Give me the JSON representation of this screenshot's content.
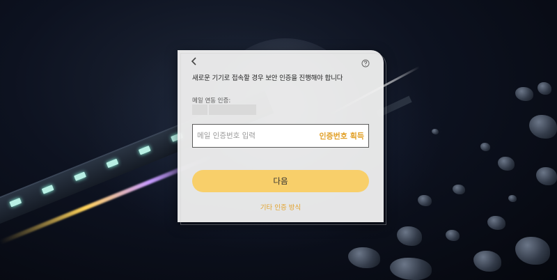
{
  "dialog": {
    "notice": "새로운 기기로 접속할 경우 보안 인증을 진행해야 합니다",
    "email_label": "메일 연동 인증:",
    "code_placeholder": "메일 인증번호 입력",
    "get_code_label": "인증번호 획득",
    "next_label": "다음",
    "other_method_label": "기타 인증 방식"
  },
  "icons": {
    "back": "chevron-left-icon",
    "help": "help-circle-icon"
  },
  "colors": {
    "accent": "#e2a12a",
    "button": "#f8cf6a",
    "dialog_bg": "#eeeeee"
  }
}
